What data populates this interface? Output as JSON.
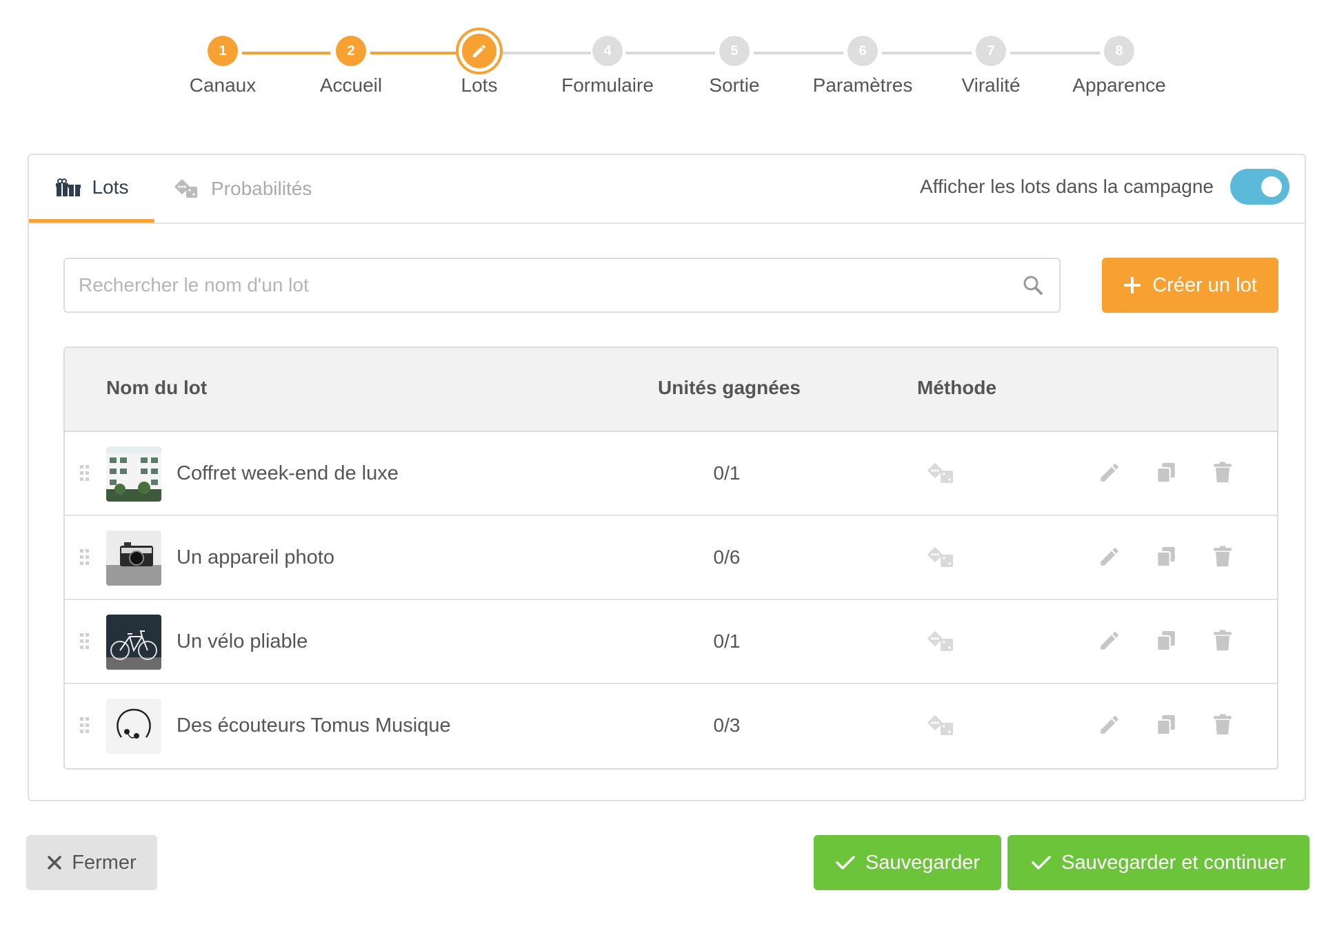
{
  "stepper": {
    "steps": [
      {
        "number": "1",
        "label": "Canaux",
        "state": "done"
      },
      {
        "number": "2",
        "label": "Accueil",
        "state": "done"
      },
      {
        "number": "",
        "label": "Lots",
        "state": "current"
      },
      {
        "number": "4",
        "label": "Formulaire",
        "state": "todo"
      },
      {
        "number": "5",
        "label": "Sortie",
        "state": "todo"
      },
      {
        "number": "6",
        "label": "Paramètres",
        "state": "todo"
      },
      {
        "number": "7",
        "label": "Viralité",
        "state": "todo"
      },
      {
        "number": "8",
        "label": "Apparence",
        "state": "todo"
      }
    ],
    "current_icon": "pencil-icon"
  },
  "tabs": {
    "lots": {
      "label": "Lots",
      "icon": "gifts-icon"
    },
    "probabilites": {
      "label": "Probabilités",
      "icon": "dice-icon"
    }
  },
  "toggle": {
    "label": "Afficher les lots dans la campagne",
    "on": true
  },
  "search": {
    "placeholder": "Rechercher le nom d'un lot",
    "value": "",
    "icon": "search-icon"
  },
  "create_button": {
    "label": "Créer un lot",
    "icon": "plus-icon"
  },
  "table": {
    "headers": {
      "name": "Nom du lot",
      "units": "Unités gagnées",
      "method": "Méthode"
    },
    "rows": [
      {
        "name": "Coffret week-end de luxe",
        "units": "0/1",
        "method_icon": "dice-icon",
        "thumbnail": "building-photo"
      },
      {
        "name": "Un appareil photo",
        "units": "0/6",
        "method_icon": "dice-icon",
        "thumbnail": "camera-photo"
      },
      {
        "name": "Un vélo pliable",
        "units": "0/1",
        "method_icon": "dice-icon",
        "thumbnail": "bicycle-photo"
      },
      {
        "name": "Des écouteurs Tomus Musique",
        "units": "0/3",
        "method_icon": "dice-icon",
        "thumbnail": "headphones-photo"
      }
    ],
    "row_actions": [
      "pencil-icon",
      "copy-icon",
      "trash-icon"
    ]
  },
  "footer": {
    "close_label": "Fermer",
    "save_label": "Sauvegarder",
    "save_continue_label": "Sauvegarder et continuer"
  },
  "colors": {
    "accent": "#f7a133",
    "success": "#6cc43a",
    "toggle": "#5bbad9",
    "inactive_step": "#dedede",
    "text": "#555555"
  }
}
